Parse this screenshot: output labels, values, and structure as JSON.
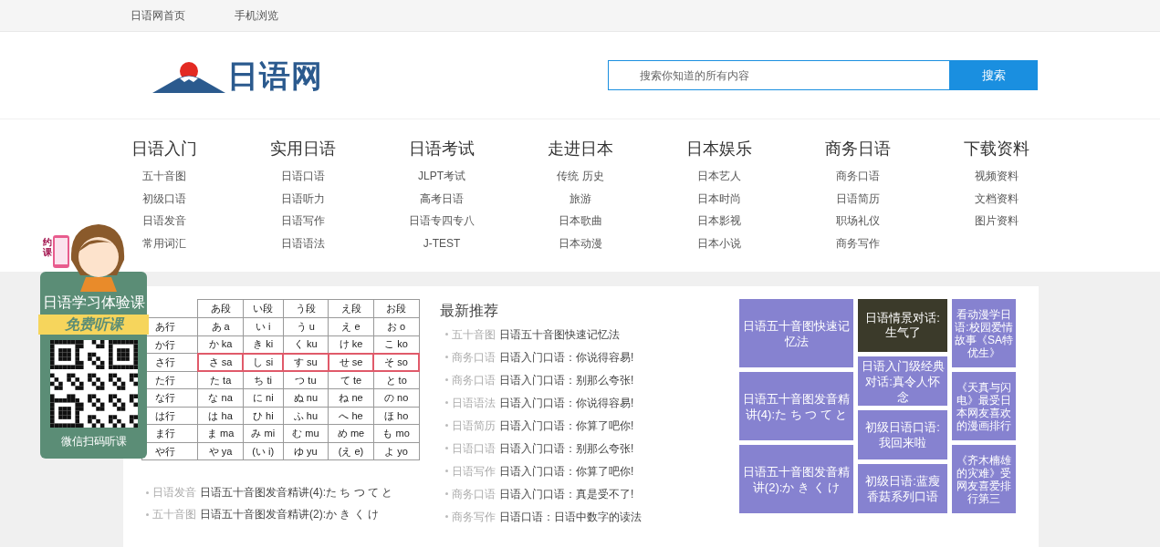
{
  "top_links": [
    "日语网首页",
    "手机浏览"
  ],
  "logo": {
    "text": "日语网"
  },
  "search": {
    "placeholder": "搜索你知道的所有内容",
    "button": "搜索"
  },
  "nav": [
    {
      "title": "日语入门",
      "items": [
        "五十音图",
        "初级口语",
        "日语发音",
        "常用词汇"
      ]
    },
    {
      "title": "实用日语",
      "items": [
        "日语口语",
        "日语听力",
        "日语写作",
        "日语语法"
      ]
    },
    {
      "title": "日语考试",
      "items": [
        "JLPT考试",
        "高考日语",
        "日语专四专八",
        "J-TEST"
      ]
    },
    {
      "title": "走进日本",
      "items": [
        "传统 历史",
        "旅游",
        "日本歌曲",
        "日本动漫"
      ]
    },
    {
      "title": "日本娱乐",
      "items": [
        "日本艺人",
        "日本时尚",
        "日本影视",
        "日本小说"
      ]
    },
    {
      "title": "商务日语",
      "items": [
        "商务口语",
        "日语简历",
        "职场礼仪",
        "商务写作"
      ]
    },
    {
      "title": "下载资料",
      "items": [
        "视频资料",
        "文档资料",
        "图片资料"
      ]
    }
  ],
  "promo": {
    "phone_label": "约课",
    "title": "日语学习体验课",
    "badge": "免费听课",
    "caption": "微信扫码听课"
  },
  "kana_table": {
    "header": [
      "あ段",
      "い段",
      "う段",
      "え段",
      "お段"
    ],
    "rows": [
      {
        "label": "あ行",
        "cells": [
          "あ a",
          "い i",
          "う u",
          "え e",
          "お o"
        ],
        "highlighted": false
      },
      {
        "label": "か行",
        "cells": [
          "か ka",
          "き ki",
          "く ku",
          "け ke",
          "こ ko"
        ],
        "highlighted": false
      },
      {
        "label": "さ行",
        "cells": [
          "さ sa",
          "し si",
          "す su",
          "せ se",
          "そ so"
        ],
        "highlighted": true
      },
      {
        "label": "た行",
        "cells": [
          "た ta",
          "ち ti",
          "つ tu",
          "て te",
          "と to"
        ],
        "highlighted": false
      },
      {
        "label": "な行",
        "cells": [
          "な na",
          "に ni",
          "ぬ nu",
          "ね ne",
          "の no"
        ],
        "highlighted": false
      },
      {
        "label": "は行",
        "cells": [
          "は ha",
          "ひ hi",
          "ふ hu",
          "へ he",
          "ほ ho"
        ],
        "highlighted": false
      },
      {
        "label": "ま行",
        "cells": [
          "ま ma",
          "み mi",
          "む mu",
          "め me",
          "も mo"
        ],
        "highlighted": false
      },
      {
        "label": "や行",
        "cells": [
          "や ya",
          "(い i)",
          "ゆ yu",
          "(え e)",
          "よ yo"
        ],
        "highlighted": false
      }
    ]
  },
  "left_articles": [
    {
      "category": "日语发音",
      "title": "日语五十音图发音精讲(4):た ち つ て と"
    },
    {
      "category": "五十音图",
      "title": "日语五十音图发音精讲(2):か き く け"
    }
  ],
  "latest": {
    "title": "最新推荐",
    "items": [
      {
        "category": "五十音图",
        "title": "日语五十音图快速记忆法"
      },
      {
        "category": "商务口语",
        "title": "日语入门口语：你说得容易!"
      },
      {
        "category": "商务口语",
        "title": "日语入门口语：别那么夸张!"
      },
      {
        "category": "日语语法",
        "title": "日语入门口语：你说得容易!"
      },
      {
        "category": "日语简历",
        "title": "日语入门口语：你算了吧你!"
      },
      {
        "category": "日语口语",
        "title": "日语入门口语：别那么夸张!"
      },
      {
        "category": "日语写作",
        "title": "日语入门口语：你算了吧你!"
      },
      {
        "category": "商务口语",
        "title": "日语入门口语：真是受不了!"
      },
      {
        "category": "商务写作",
        "title": "日语口语：日语中数字的读法"
      }
    ]
  },
  "tiles": [
    [
      {
        "kind": "text",
        "text": "日语五十音图快速记忆法"
      },
      {
        "kind": "text",
        "text": "日语五十音图发音精讲(4):た ち つ て と"
      },
      {
        "kind": "text",
        "text": "日语五十音图发音精讲(2):か き く け"
      }
    ],
    [
      {
        "kind": "photo",
        "text": "日语情景对话:生气了"
      },
      {
        "kind": "text",
        "text": "日语入门级经典对话:真令人怀念"
      },
      {
        "kind": "text",
        "text": "初级日语口语:我回来啦"
      },
      {
        "kind": "text",
        "text": "初级日语:蓝瘦香菇系列口语"
      }
    ],
    [
      {
        "kind": "text",
        "text": "看动漫学日语:校园爱情故事《SA特优生》"
      },
      {
        "kind": "text",
        "text": "《天真与闪电》最受日本网友喜欢的漫画排行"
      },
      {
        "kind": "text",
        "text": "《齐木楠雄的灾难》受网友喜爱排行第三"
      }
    ]
  ]
}
